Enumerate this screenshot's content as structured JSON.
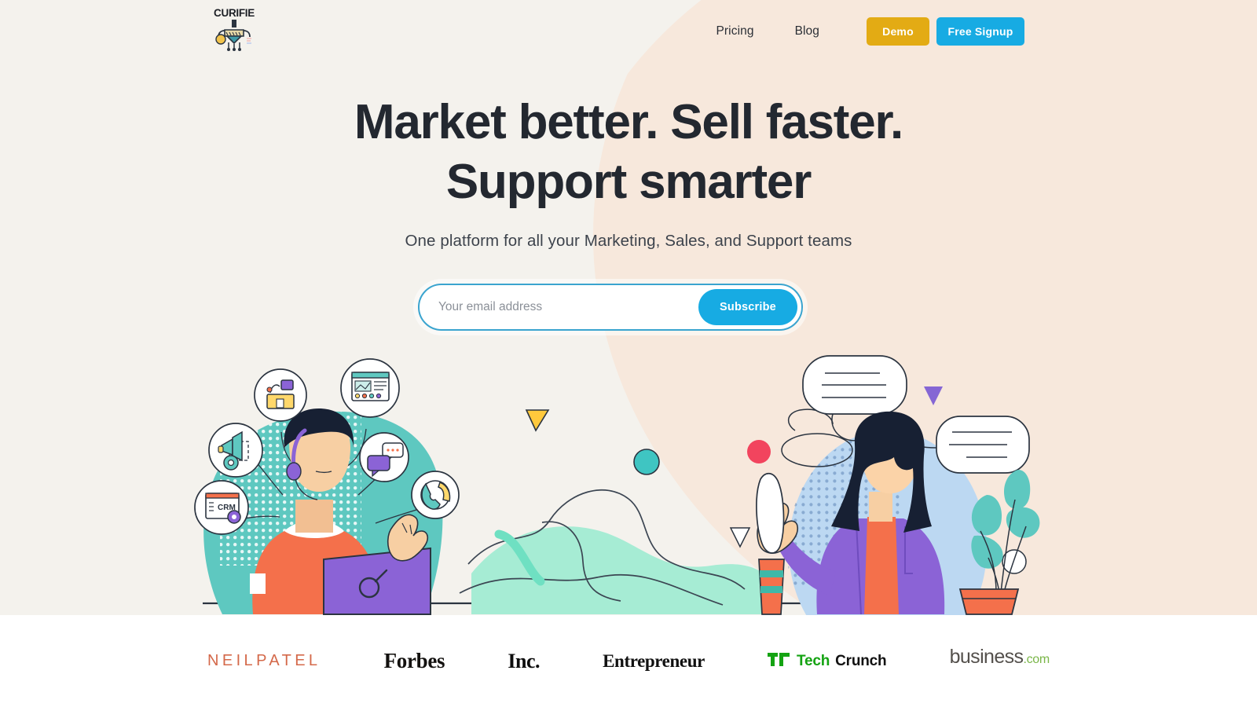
{
  "brand": {
    "name": "CURIFIE",
    "logo_icon": "robot-machine-icon"
  },
  "nav": {
    "links": [
      {
        "label": "Pricing",
        "name": "nav-link-pricing"
      },
      {
        "label": "Blog",
        "name": "nav-link-blog"
      }
    ],
    "buttons": [
      {
        "label": "Demo",
        "color": "#e3ab14"
      },
      {
        "label": "Free Signup",
        "color": "#17abe3"
      }
    ]
  },
  "hero": {
    "headline_line1": "Market better. Sell faster.",
    "headline_line2": "Support smarter",
    "subhead": "One platform for all your Marketing, Sales, and Support teams",
    "bg_left": "#f4f2ed",
    "bg_right": "#f7e8dc"
  },
  "subscribe": {
    "placeholder": "Your email address",
    "value": "",
    "button_label": "Subscribe",
    "button_color": "#17abe3",
    "border_color": "#3aa4cf"
  },
  "illustration": {
    "left_scene": "support-agent-with-headset-at-laptop",
    "left_bubbles": [
      "info-desk-icon",
      "dashboard-window-icon",
      "megaphone-gear-icon",
      "chat-bubbles-icon",
      "phone-handset-icon",
      "crm-window-icon"
    ],
    "crm_label": "CRM",
    "right_scene": "woman-with-speech-bubbles-and-plant",
    "decor": [
      "yellow-triangle",
      "teal-circle",
      "red-circle",
      "purple-triangle",
      "white-triangle",
      "mint-blob"
    ]
  },
  "logobar": {
    "brands": [
      {
        "name": "NEILPATEL",
        "label": "NEILPATEL",
        "color": "#d4694a"
      },
      {
        "name": "Forbes",
        "label": "Forbes",
        "color": "#13110f"
      },
      {
        "name": "Inc.",
        "label": "Inc.",
        "color": "#0d0d0d"
      },
      {
        "name": "Entrepreneur",
        "label": "Entrepreneur",
        "color": "#111111"
      },
      {
        "name": "TechCrunch",
        "label_tech": "Tech",
        "label_crunch": "Crunch",
        "color": "#14a312"
      },
      {
        "name": "business.com",
        "label_main": "business",
        "label_com": ".com",
        "color": "#7ab648"
      }
    ]
  }
}
